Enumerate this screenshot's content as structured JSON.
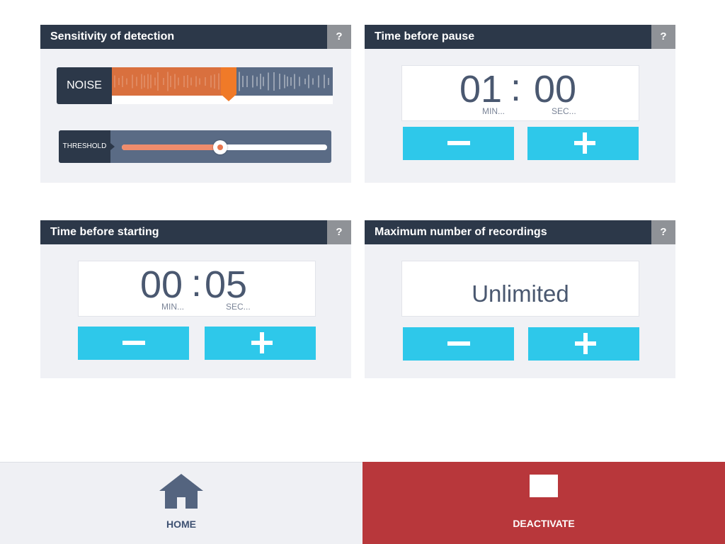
{
  "panels": {
    "sensitivity": {
      "title": "Sensitivity of detection",
      "help": "?",
      "noise_label": "NOISE",
      "noise_level": 0.53,
      "threshold_label": "THRESHOLD",
      "threshold_level": 0.48
    },
    "pause": {
      "title": "Time before pause",
      "help": "?",
      "minutes": "01",
      "seconds": "00",
      "separator": ":",
      "min_label": "MIN...",
      "sec_label": "SEC...",
      "minus": "−",
      "plus": "+"
    },
    "starting": {
      "title": "Time before starting",
      "help": "?",
      "minutes": "00",
      "seconds": "05",
      "separator": ":",
      "min_label": "MIN...",
      "sec_label": "SEC...",
      "minus": "−",
      "plus": "+"
    },
    "max_recordings": {
      "title": "Maximum number of recordings",
      "help": "?",
      "value": "Unlimited",
      "minus": "−",
      "plus": "+"
    }
  },
  "bottom_bar": {
    "home_label": "HOME",
    "deactivate_label": "DEACTIVATE"
  },
  "icons": {
    "home": "home-icon",
    "deactivate": "stop-icon"
  },
  "colors": {
    "header": "#2c3849",
    "accent_button": "#2ec8ea",
    "deactivate": "#b8373b",
    "noise_fill": "#d9703e",
    "marker": "#f07a28"
  }
}
